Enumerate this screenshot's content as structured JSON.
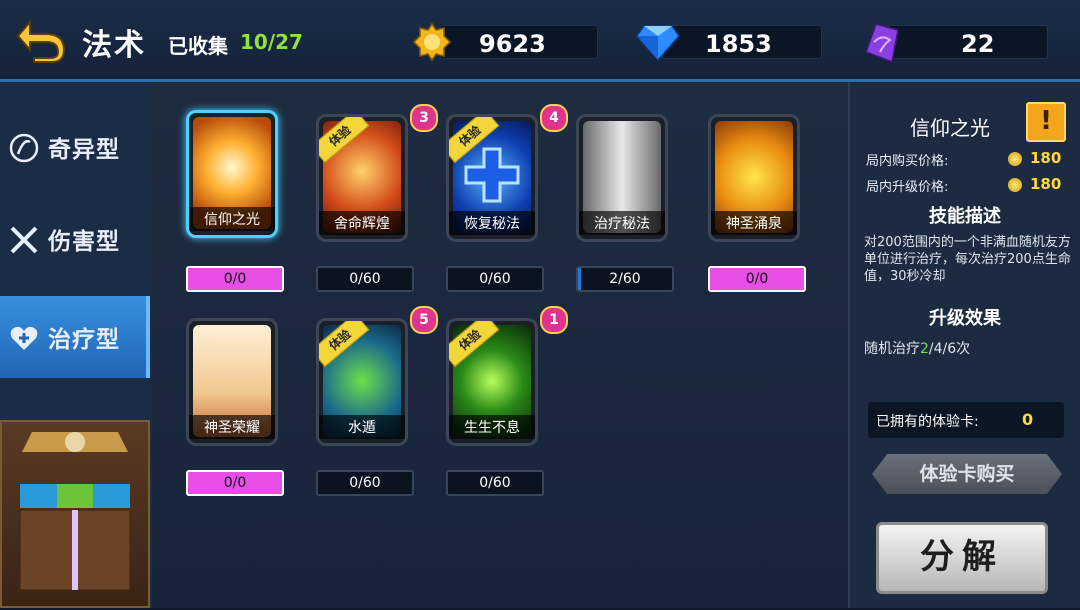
{
  "header": {
    "title": "法术",
    "collected_label": "已收集",
    "collected_count": "10/27",
    "gold": "9623",
    "diamond": "1853",
    "crystal": "22"
  },
  "tabs": [
    {
      "label": "奇异型",
      "icon": "swirl-icon"
    },
    {
      "label": "伤害型",
      "icon": "crossed-swords-icon"
    },
    {
      "label": "治疗型",
      "icon": "heart-plus-icon"
    }
  ],
  "cards": [
    {
      "name": "信仰之光",
      "progress": "0/0",
      "trial": false,
      "badge": "",
      "selected": true
    },
    {
      "name": "舍命辉煌",
      "progress": "0/60",
      "trial": true,
      "badge": "3"
    },
    {
      "name": "恢复秘法",
      "progress": "0/60",
      "trial": true,
      "badge": "4"
    },
    {
      "name": "治疗秘法",
      "progress": "2/60",
      "trial": false,
      "badge": ""
    },
    {
      "name": "神圣涌泉",
      "progress": "0/0",
      "trial": false,
      "badge": ""
    },
    {
      "name": "神圣荣耀",
      "progress": "0/0",
      "trial": false,
      "badge": ""
    },
    {
      "name": "水遁",
      "progress": "0/60",
      "trial": true,
      "badge": "5"
    },
    {
      "name": "生生不息",
      "progress": "0/60",
      "trial": true,
      "badge": "1"
    }
  ],
  "trial_label": "体验",
  "detail": {
    "name": "信仰之光",
    "warn": "!",
    "buy_price_label": "局内购买价格:",
    "buy_price": "180",
    "upgrade_price_label": "局内升级价格:",
    "upgrade_price": "180",
    "skill_desc_head": "技能描述",
    "skill_desc": "对200范围内的一个非满血随机友方单位进行治疗，每次治疗200点生命值，30秒冷却",
    "upgrade_head": "升级效果",
    "upgrade_prefix": "随机治疗",
    "upgrade_highlight": "2",
    "upgrade_suffix": "/4/6次",
    "owned_label": "已拥有的体验卡:",
    "owned_count": "0",
    "buy_button": "体验卡购买",
    "decompose_button": "分解"
  },
  "colors": {
    "accent": "#49d4ff",
    "pink_bar": "#e64ee6",
    "gold": "#ffd93a",
    "green": "#8fe33a"
  }
}
